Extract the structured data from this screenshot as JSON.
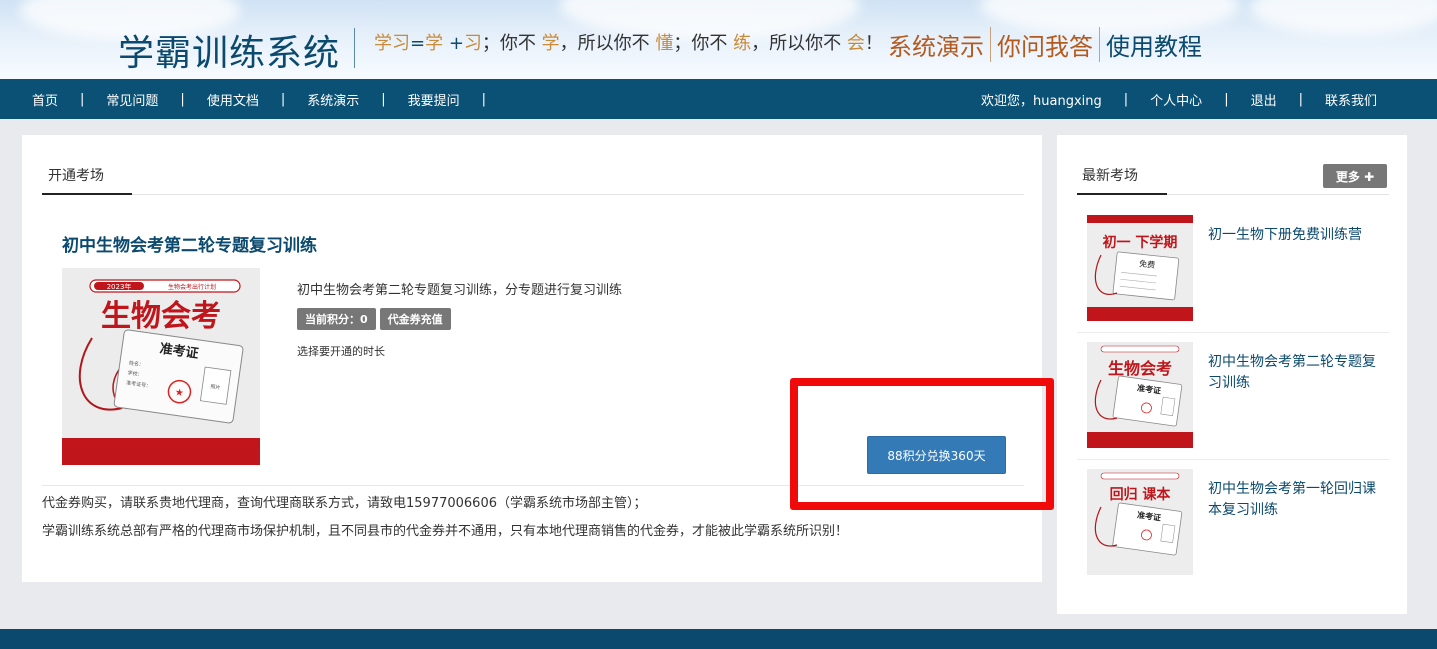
{
  "header": {
    "site_title": "学霸训练系统",
    "slogan": {
      "p1": "学习",
      "p2": "=",
      "p3": "学",
      "p4": " +",
      "p5": "习",
      "p6": "；你不 ",
      "p7": "学",
      "p8": "，所以你不 ",
      "p9": "懂",
      "p10": "；你不 ",
      "p11": "练",
      "p12": "，所以你不 ",
      "p13": "会",
      "p14": "！"
    },
    "links": [
      "系统演示",
      "你问我答",
      "使用教程"
    ]
  },
  "nav": {
    "left_items": [
      "首页",
      "常见问题",
      "使用文档",
      "系统演示",
      "我要提问"
    ],
    "separator": "|",
    "right_items": [
      "欢迎您，huangxing",
      "个人中心",
      "退出",
      "联系我们"
    ]
  },
  "main": {
    "tab_title": "开通考场",
    "course": {
      "title": "初中生物会考第二轮专题复习训练",
      "description": "初中生物会考第二轮专题复习训练，分专题进行复习训练",
      "points_badge": "当前积分：0",
      "voucher_badge": "代金券充值",
      "duration_label": "选择要开通的时长",
      "exchange_button": "88积分兑换360天",
      "cover": {
        "year": "2023年",
        "plan": "生物会考出行计划",
        "big_text": "生物会考",
        "card_title": "准考证",
        "f_name": "姓名：",
        "f_school": "学校：",
        "f_no": "准考证号：",
        "f_photo": "照片"
      }
    },
    "notice_1": "代金券购买，请联系贵地代理商，查询代理商联系方式，请致电15977006606（学霸系统市场部主管）；",
    "notice_2": "学霸训练系统总部有严格的代理商市场保护机制，且不同县市的代金券并不通用，只有本地代理商销售的代金券，才能被此学霸系统所识别！"
  },
  "sidebar": {
    "title": "最新考场",
    "more_button": "更多",
    "items": [
      {
        "label": "初一生物下册免费训练营",
        "thumb_big": "初一  下学期",
        "thumb_small": "免费"
      },
      {
        "label": "初中生物会考第二轮专题复习训练",
        "thumb_big": "生物会考",
        "thumb_small": "准考证"
      },
      {
        "label": "初中生物会考第一轮回归课本复习训练",
        "thumb_big": "回归  课本",
        "thumb_small": "准考证"
      }
    ]
  },
  "colors": {
    "nav_bg": "#0b5176",
    "title_blue": "#0b4a6e",
    "accent_orange": "#b35a1f",
    "button_blue": "#337ab7",
    "badge_gray": "#777777",
    "highlight_red": "#f10a0a",
    "cover_red": "#c0161b"
  }
}
